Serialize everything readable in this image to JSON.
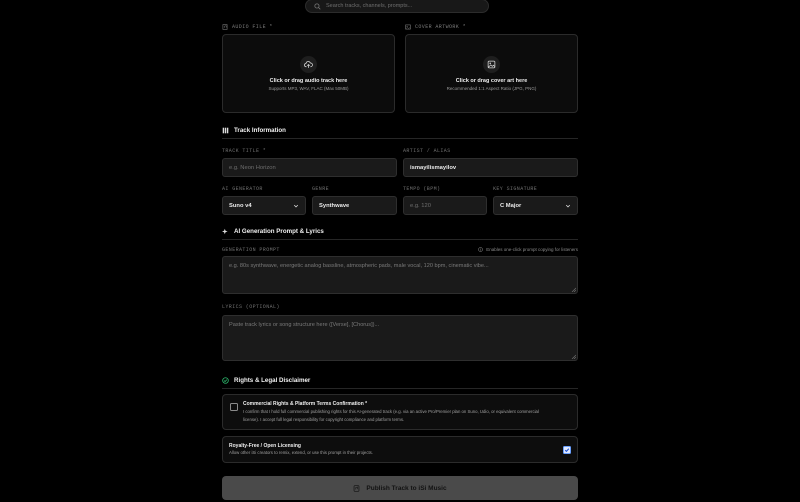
{
  "search": {
    "placeholder": "Search tracks, channels, prompts..."
  },
  "upload": {
    "audio": {
      "label": "AUDIO FILE *",
      "title": "Click or drag audio track here",
      "subtitle": "Supports MP3, WAV, FLAC (Max 50MB)"
    },
    "cover": {
      "label": "COVER ARTWORK *",
      "title": "Click or drag cover art here",
      "subtitle": "Recommended 1:1 Aspect Ratio (JPG, PNG)"
    }
  },
  "track_info": {
    "heading": "Track Information",
    "title_label": "TRACK TITLE *",
    "title_placeholder": "e.g. Neon Horizon",
    "artist_label": "ARTIST / ALIAS",
    "artist_value": "ismayilismayilov",
    "generator_label": "AI GENERATOR",
    "generator_value": "Suno v4",
    "genre_label": "GENRE",
    "genre_value": "Synthwave",
    "tempo_label": "TEMPO (BPM)",
    "tempo_placeholder": "e.g. 120",
    "key_label": "KEY SIGNATURE",
    "key_value": "C Major"
  },
  "prompt": {
    "heading": "AI Generation Prompt & Lyrics",
    "hint": "Enables one-click prompt copying for listeners",
    "gen_label": "GENERATION PROMPT",
    "gen_placeholder": "e.g. 80s synthwave, energetic analog bassline, atmospheric pads, male vocal, 120 bpm, cinematic vibe...",
    "lyrics_label": "LYRICS (OPTIONAL)",
    "lyrics_placeholder": "Paste track lyrics or song structure here ([Verse], [Chorus])..."
  },
  "rights": {
    "heading": "Rights & Legal Disclaimer",
    "commercial_title": "Commercial Rights & Platform Terms Confirmation *",
    "commercial_desc_1": "I confirm that I hold full commercial publishing rights for this AI-generated track (e.g. via an active Pro/Premier plan on Suno, Udio, or equivalent commercial",
    "commercial_desc_2": "license). I accept full legal responsibility for copyright compliance and platform terms.",
    "commercial_checked": false,
    "royalty_title": "Royalty-Free / Open Licensing",
    "royalty_desc": "Allow other iSi creators to remix, extend, or use this prompt in their projects.",
    "royalty_checked": true
  },
  "publish": {
    "label": "Publish Track to iSi Music"
  },
  "colors": {
    "accent_green": "#2fbf71",
    "checkbox_blue": "#6aa0ff",
    "button_bg": "#4a4a4a"
  }
}
